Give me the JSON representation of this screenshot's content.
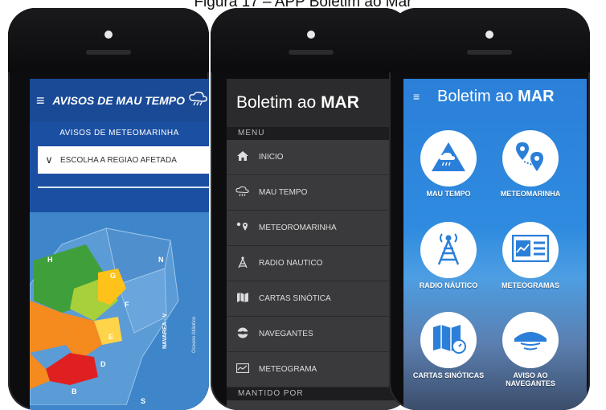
{
  "caption": "Figura 17 – APP Boletim ao Mar",
  "phone1": {
    "title": "AVISOS DE MAU TEMPO",
    "subtitle": "AVISOS DE METEOMARINHA",
    "select_value": "ESCOLHA A REGIÃO AFETADA",
    "map_labels": [
      "H",
      "N",
      "G",
      "F",
      "E",
      "D",
      "B",
      "S",
      "NAVAREA - V",
      "Oceano Atlântico"
    ]
  },
  "phone2": {
    "title_light": "Boletim ao",
    "title_bold": "MAR",
    "section_menu": "MENU",
    "items": [
      {
        "label": "INICIO",
        "icon": "home-icon"
      },
      {
        "label": "MAU TEMPO",
        "icon": "storm-cloud-icon"
      },
      {
        "label": "METEOROMARINHA",
        "icon": "map-pin-icon"
      },
      {
        "label": "RADIO NAUTICO",
        "icon": "radio-tower-icon"
      },
      {
        "label": "CARTAS SINÓTICA",
        "icon": "map-icon"
      },
      {
        "label": "NAVEGANTES",
        "icon": "lifebuoy-icon"
      },
      {
        "label": "METEOGRAMA",
        "icon": "chart-icon"
      }
    ],
    "section_footer": "MANTIDO POR"
  },
  "phone3": {
    "title_light": "Boletim ao",
    "title_bold": "MAR",
    "tiles": [
      {
        "label": "MAU TEMPO",
        "icon": "storm-cloud-icon"
      },
      {
        "label": "METEOMARINHA",
        "icon": "map-pin-icon"
      },
      {
        "label": "RADIO NÁUTICO",
        "icon": "radio-tower-icon"
      },
      {
        "label": "METEOGRAMAS",
        "icon": "chart-icon"
      },
      {
        "label": "CARTAS SINÓTICAS",
        "icon": "map-icon"
      },
      {
        "label": "AVISO AO NAVEGANTES",
        "icon": "lighthouse-icon"
      }
    ]
  },
  "colors": {
    "phone1_bg": "#1b4fa1",
    "phone2_bg": "#3a3a3c",
    "phone3_bg": "#2f8be0",
    "map_red": "#e02020",
    "map_orange": "#f58a1e"
  }
}
